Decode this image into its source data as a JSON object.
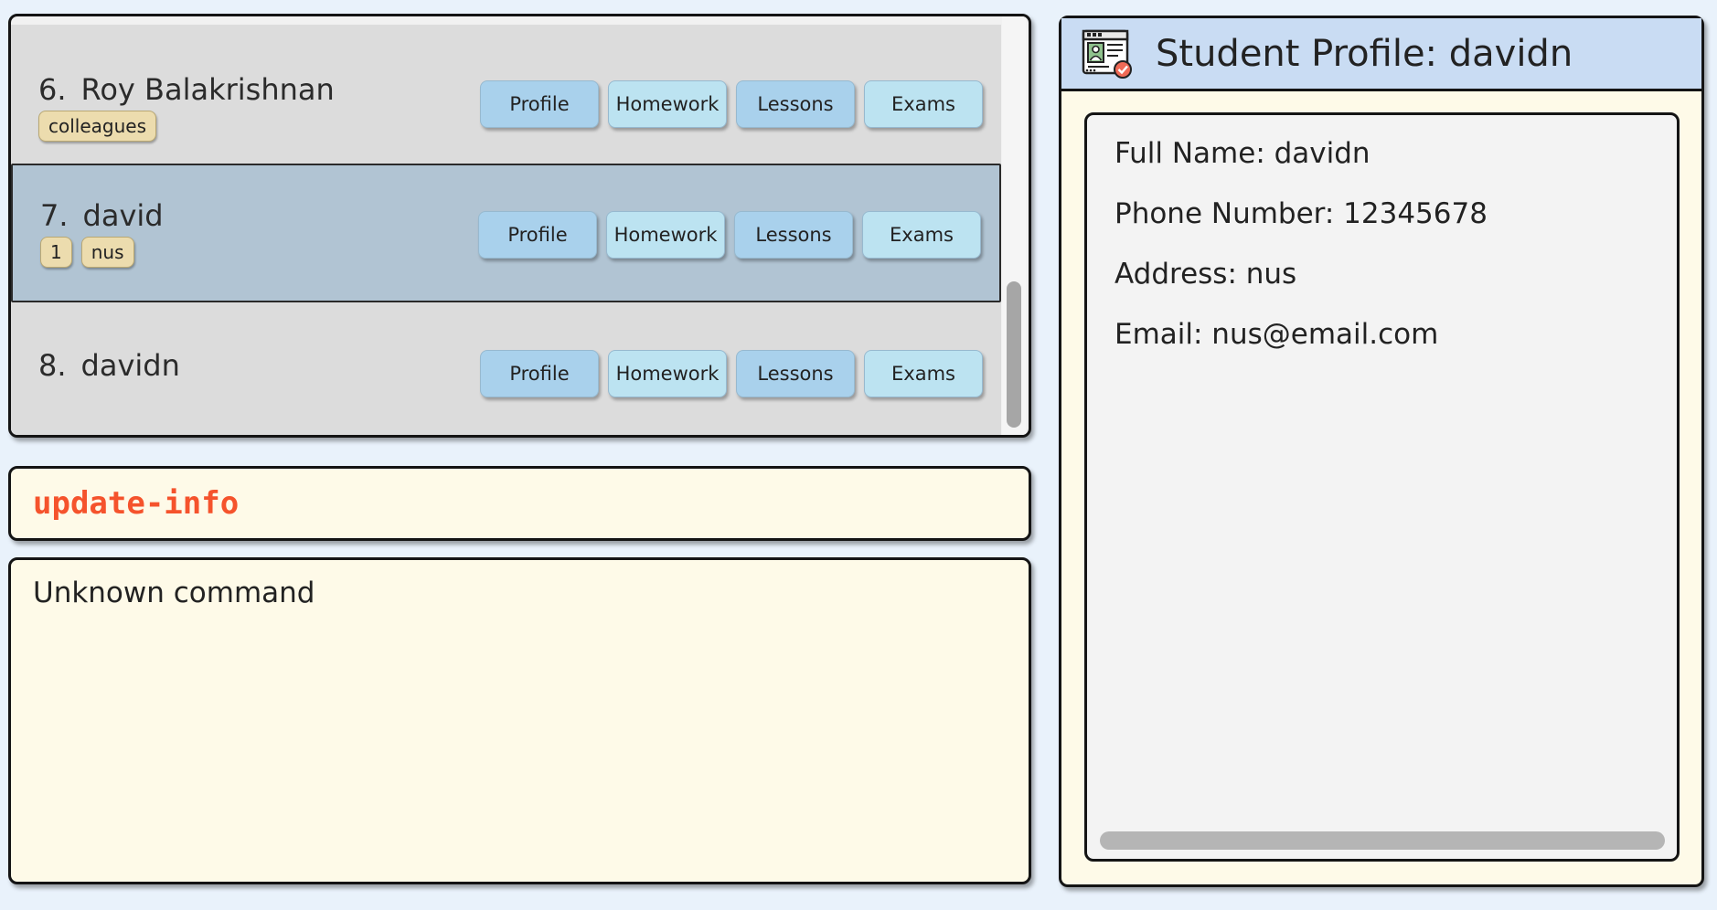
{
  "person_list": {
    "items": [
      {
        "index": "6.",
        "name": "Roy Balakrishnan",
        "tags": [
          "colleagues"
        ],
        "selected": false
      },
      {
        "index": "7.",
        "name": "david",
        "tags": [
          "1",
          "nus"
        ],
        "selected": true
      },
      {
        "index": "8.",
        "name": "davidn",
        "tags": [],
        "selected": false
      }
    ],
    "buttons": {
      "profile": "Profile",
      "homework": "Homework",
      "lessons": "Lessons",
      "exams": "Exams"
    }
  },
  "command_box": {
    "value": "update-info"
  },
  "result_display": {
    "text": "Unknown command"
  },
  "profile": {
    "title": "Student Profile: davidn",
    "full_name": "Full Name: davidn",
    "phone": "Phone Number: 12345678",
    "address": "Address: nus",
    "email": "Email: nus@email.com",
    "icon": "student-profile-icon"
  },
  "colors": {
    "accent_command": "#f5532c",
    "selected_row": "#b1c4d3",
    "header_bg": "#c9dcf3",
    "panel_bg": "#fefae8"
  }
}
